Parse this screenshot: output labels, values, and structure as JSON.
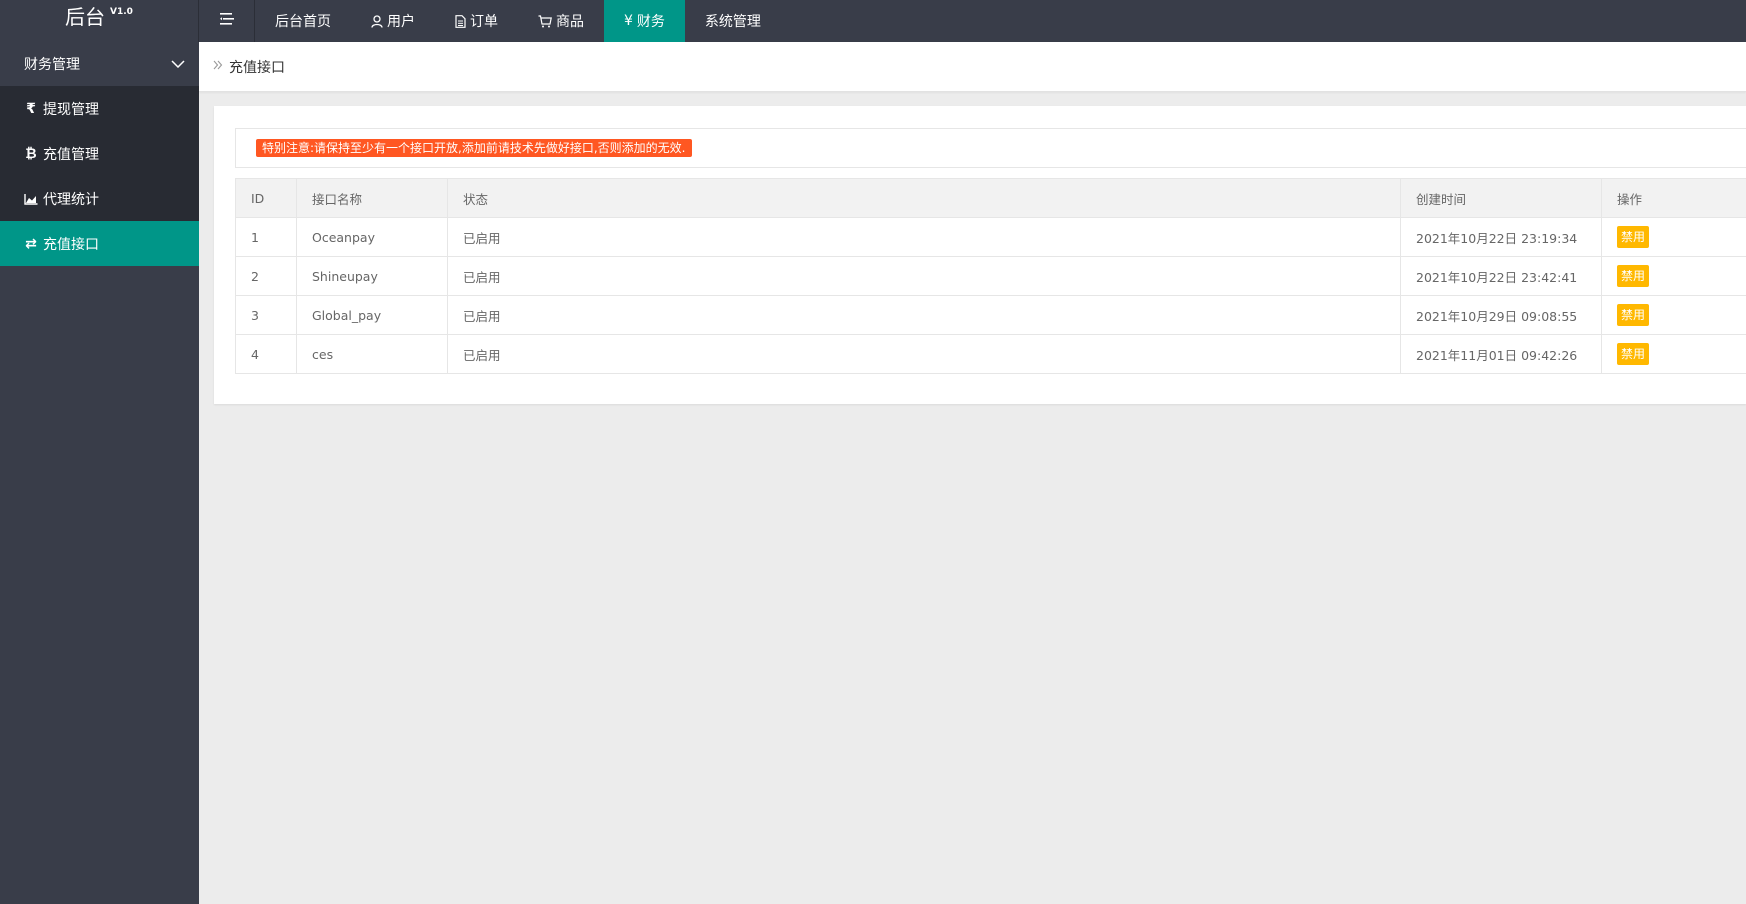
{
  "app": {
    "name": "后台",
    "version": "V1.0"
  },
  "topnav": {
    "items": [
      {
        "label": "后台首页",
        "icon": "",
        "active": false
      },
      {
        "label": "用户",
        "icon": "user-icon",
        "active": false
      },
      {
        "label": "订单",
        "icon": "document-icon",
        "active": false
      },
      {
        "label": "商品",
        "icon": "cart-icon",
        "active": false
      },
      {
        "label": "财务",
        "icon": "yen-icon",
        "active": true
      },
      {
        "label": "系统管理",
        "icon": "",
        "active": false
      }
    ]
  },
  "sidebar": {
    "group_label": "财务管理",
    "items": [
      {
        "label": "提现管理",
        "icon": "rupee-icon",
        "glyph": "₹"
      },
      {
        "label": "充值管理",
        "icon": "bitcoin-icon",
        "glyph": "₿"
      },
      {
        "label": "代理统计",
        "icon": "area-chart-icon",
        "glyph": ""
      },
      {
        "label": "充值接口",
        "icon": "exchange-icon",
        "glyph": "⇄"
      }
    ]
  },
  "breadcrumb": {
    "current": "充值接口"
  },
  "notice": "特别注意:请保持至少有一个接口开放,添加前请技术先做好接口,否则添加的无效.",
  "table": {
    "headers": {
      "id": "ID",
      "name": "接口名称",
      "status": "状态",
      "created": "创建时间",
      "action": "操作"
    },
    "rows": [
      {
        "id": "1",
        "name": "Oceanpay",
        "status": "已启用",
        "created": "2021年10月22日 23:19:34",
        "action": "禁用"
      },
      {
        "id": "2",
        "name": "Shineupay",
        "status": "已启用",
        "created": "2021年10月22日 23:42:41",
        "action": "禁用"
      },
      {
        "id": "3",
        "name": "Global_pay",
        "status": "已启用",
        "created": "2021年10月29日 09:08:55",
        "action": "禁用"
      },
      {
        "id": "4",
        "name": "ces",
        "status": "已启用",
        "created": "2021年11月01日 09:42:26",
        "action": "禁用"
      }
    ]
  },
  "colors": {
    "accent": "#009688",
    "dark": "#393d49",
    "notice": "#ff5722",
    "warn_button": "#ffb800",
    "status_ok": "#5fb878"
  }
}
